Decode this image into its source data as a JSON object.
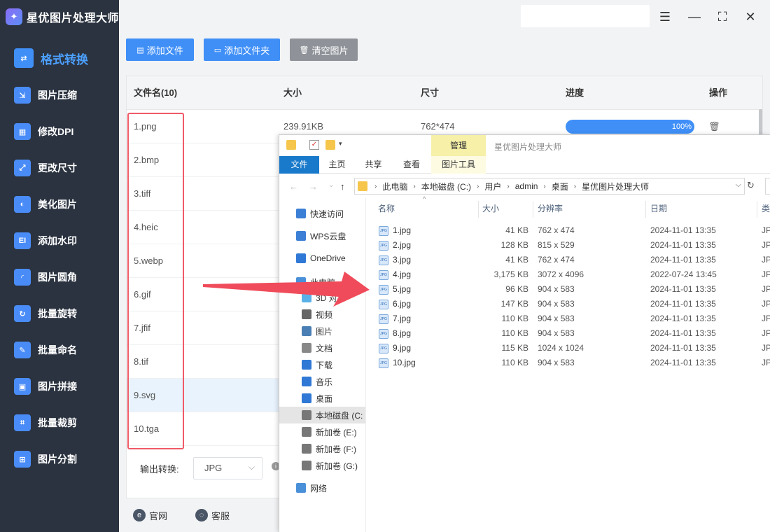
{
  "app": {
    "title": "星优图片处理大师",
    "logo_icon": "app-logo-icon"
  },
  "sidebar": {
    "items": [
      {
        "label": "格式转换",
        "icon": "format-convert-icon",
        "glyph": "⇄",
        "active": true
      },
      {
        "label": "图片压缩",
        "icon": "compress-icon",
        "glyph": "⇲"
      },
      {
        "label": "修改DPI",
        "icon": "dpi-icon",
        "glyph": "▦"
      },
      {
        "label": "更改尺寸",
        "icon": "resize-icon",
        "glyph": "⤢"
      },
      {
        "label": "美化图片",
        "icon": "beautify-icon",
        "glyph": "◐"
      },
      {
        "label": "添加水印",
        "icon": "watermark-icon",
        "glyph": "EI"
      },
      {
        "label": "图片圆角",
        "icon": "round-corner-icon",
        "glyph": "◜"
      },
      {
        "label": "批量旋转",
        "icon": "rotate-icon",
        "glyph": "↻"
      },
      {
        "label": "批量命名",
        "icon": "rename-icon",
        "glyph": "✎"
      },
      {
        "label": "图片拼接",
        "icon": "collage-icon",
        "glyph": "▣"
      },
      {
        "label": "批量裁剪",
        "icon": "crop-icon",
        "glyph": "⌗"
      },
      {
        "label": "图片分割",
        "icon": "split-icon",
        "glyph": "⊞"
      }
    ]
  },
  "toolbar": {
    "add_file": "添加文件",
    "add_folder": "添加文件夹",
    "clear": "清空图片"
  },
  "table": {
    "headers": {
      "name": "文件名(10)",
      "size": "大小",
      "dims": "尺寸",
      "progress": "进度",
      "action": "操作"
    },
    "rows": [
      {
        "name": "1.png",
        "size": "239.91KB",
        "dims": "762*474",
        "progress": 1.0,
        "progress_text": "100%"
      },
      {
        "name": "2.bmp"
      },
      {
        "name": "3.tiff"
      },
      {
        "name": "4.heic"
      },
      {
        "name": "5.webp"
      },
      {
        "name": "6.gif"
      },
      {
        "name": "7.jfif"
      },
      {
        "name": "8.tif"
      },
      {
        "name": "9.svg",
        "selected": true
      },
      {
        "name": "10.tga"
      }
    ]
  },
  "output": {
    "label": "输出转换:",
    "format": "JPG"
  },
  "footer": {
    "website": "官网",
    "support": "客服"
  },
  "explorer": {
    "manage_tab": "管理",
    "title": "星优图片处理大师",
    "ribbon": {
      "file": "文件",
      "home": "主页",
      "share": "共享",
      "view": "查看",
      "tools": "图片工具"
    },
    "breadcrumb": [
      "此电脑",
      "本地磁盘 (C:)",
      "用户",
      "admin",
      "桌面",
      "星优图片处理大师"
    ],
    "tree": [
      {
        "label": "快速访问",
        "color": "#3b7fd6"
      },
      {
        "label": "WPS云盘",
        "color": "#3b7fd6"
      },
      {
        "label": "OneDrive",
        "color": "#2f78d6"
      },
      {
        "label": "此电脑",
        "color": "#4a90d9"
      },
      {
        "label": "3D 对象",
        "color": "#5ab0e8"
      },
      {
        "label": "视频",
        "color": "#666666"
      },
      {
        "label": "图片",
        "color": "#4a7fb5"
      },
      {
        "label": "文档",
        "color": "#888888"
      },
      {
        "label": "下载",
        "color": "#2f78d6"
      },
      {
        "label": "音乐",
        "color": "#2f78d6"
      },
      {
        "label": "桌面",
        "color": "#2f78d6"
      },
      {
        "label": "本地磁盘 (C:",
        "color": "#777777",
        "selected": true
      },
      {
        "label": "新加卷 (E:)",
        "color": "#777777"
      },
      {
        "label": "新加卷 (F:)",
        "color": "#777777"
      },
      {
        "label": "新加卷 (G:)",
        "color": "#777777"
      },
      {
        "label": "网络",
        "color": "#4a90d9"
      }
    ],
    "columns": {
      "name": "名称",
      "size": "大小",
      "res": "分辨率",
      "date": "日期",
      "type": "类"
    },
    "files": [
      {
        "name": "1.jpg",
        "size": "41 KB",
        "res": "762 x 474",
        "date": "2024-11-01 13:35",
        "type": "JP"
      },
      {
        "name": "2.jpg",
        "size": "128 KB",
        "res": "815 x 529",
        "date": "2024-11-01 13:35",
        "type": "JP"
      },
      {
        "name": "3.jpg",
        "size": "41 KB",
        "res": "762 x 474",
        "date": "2024-11-01 13:35",
        "type": "JP"
      },
      {
        "name": "4.jpg",
        "size": "3,175 KB",
        "res": "3072 x 4096",
        "date": "2022-07-24 13:45",
        "type": "JP"
      },
      {
        "name": "5.jpg",
        "size": "96 KB",
        "res": "904 x 583",
        "date": "2024-11-01 13:35",
        "type": "JP"
      },
      {
        "name": "6.jpg",
        "size": "147 KB",
        "res": "904 x 583",
        "date": "2024-11-01 13:35",
        "type": "JP"
      },
      {
        "name": "7.jpg",
        "size": "110 KB",
        "res": "904 x 583",
        "date": "2024-11-01 13:35",
        "type": "JP"
      },
      {
        "name": "8.jpg",
        "size": "110 KB",
        "res": "904 x 583",
        "date": "2024-11-01 13:35",
        "type": "JP"
      },
      {
        "name": "9.jpg",
        "size": "115 KB",
        "res": "1024 x 1024",
        "date": "2024-11-01 13:35",
        "type": "JP"
      },
      {
        "name": "10.jpg",
        "size": "110 KB",
        "res": "904 x 583",
        "date": "2024-11-01 13:35",
        "type": "JP"
      }
    ],
    "file_icon_text": "JPG"
  },
  "colors": {
    "accent": "#3f8ff7",
    "sidebar_bg": "#2b3340",
    "highlight": "#f05a68",
    "manage_tab": "#f6f0a8"
  }
}
